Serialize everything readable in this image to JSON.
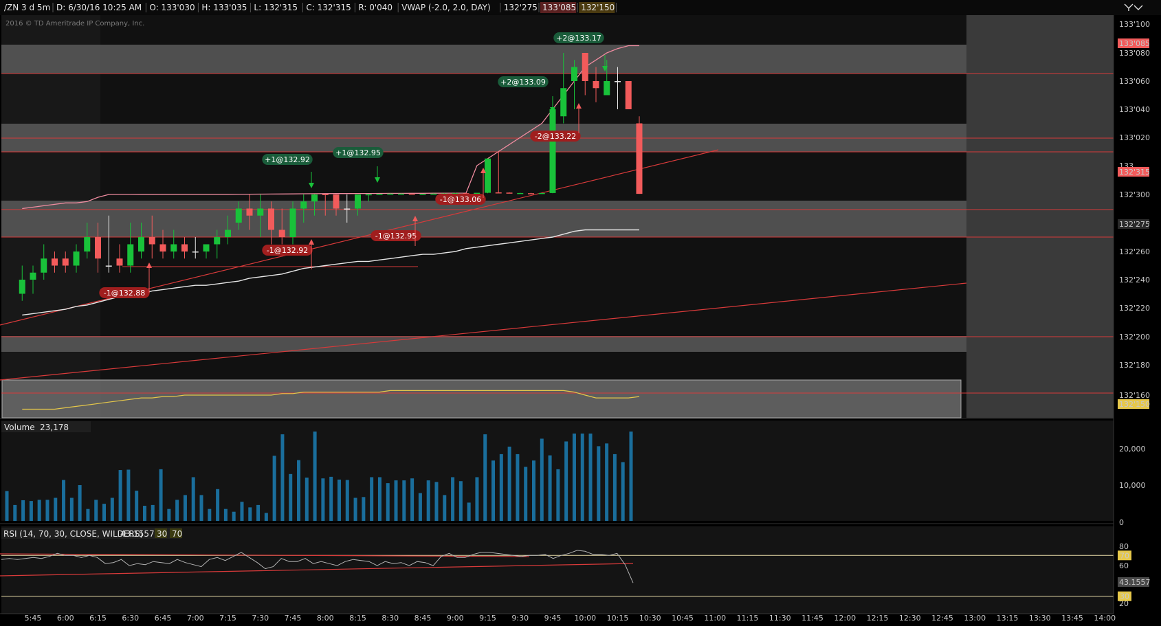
{
  "header": {
    "fields": [
      {
        "text": "/ZN 3 d 5m",
        "color": "#e6e6e6"
      },
      {
        "text": "D: 6/30/16 10:25 AM",
        "color": "#e6e6e6"
      },
      {
        "text": "O: 133'030",
        "color": "#e6e6e6"
      },
      {
        "text": "H: 133'035",
        "color": "#e6e6e6"
      },
      {
        "text": "L: 132'315",
        "color": "#e6e6e6"
      },
      {
        "text": "C: 132'315",
        "color": "#e6e6e6"
      },
      {
        "text": "R: 0'040",
        "color": "#e6e6e6"
      },
      {
        "text": "VWAP (-2.0, 2.0, DAY)",
        "color": "#ffffff"
      },
      {
        "text": "132'275",
        "color": "#ffffff"
      },
      {
        "text": "133'085",
        "color": "#f08c8c"
      },
      {
        "text": "132'150",
        "color": "#e6c84a"
      }
    ],
    "icon": "expand-collapse-icon"
  },
  "watermark": "2016 © TD Ameritrade IP Company, Inc.",
  "colors": {
    "up": "#19c23a",
    "down": "#f25b5b",
    "vwap": "#e6e6e6",
    "band_upper": "#f08ca0",
    "band_lower": "#e6c84a",
    "volume": "#1a6e9c",
    "rsi": "#b4b4b4",
    "ref_line": "#d83a3a",
    "zone": "#5a5a5a",
    "tag_buy": "#1a5c3a",
    "tag_sell": "#a01e1e"
  },
  "chart_data": [
    {
      "type": "candlestick",
      "panel": "price",
      "x": [
        "5:40",
        "5:45",
        "5:50",
        "5:55",
        "6:00",
        "6:05",
        "6:10",
        "6:15",
        "6:20",
        "6:25",
        "6:30",
        "6:35",
        "6:40",
        "6:45",
        "6:50",
        "6:55",
        "7:00",
        "7:05",
        "7:10",
        "7:15",
        "7:20",
        "7:25",
        "7:30",
        "7:35",
        "7:40",
        "7:45",
        "7:50",
        "7:55",
        "8:00",
        "8:05",
        "8:10",
        "8:15",
        "8:20",
        "8:25",
        "8:30",
        "8:35",
        "8:40",
        "8:45",
        "8:50",
        "8:55",
        "9:00",
        "9:05",
        "9:10",
        "9:15",
        "9:20",
        "9:25",
        "9:30",
        "9:35",
        "9:40",
        "9:45",
        "9:50",
        "9:55",
        "10:00",
        "10:05",
        "10:10",
        "10:15",
        "10:20",
        "10:25"
      ],
      "open": [
        132.23,
        132.24,
        132.245,
        132.255,
        132.255,
        132.25,
        132.26,
        132.27,
        132.25,
        132.255,
        132.25,
        132.26,
        132.27,
        132.265,
        132.26,
        132.265,
        132.26,
        132.26,
        132.265,
        132.27,
        132.28,
        132.29,
        132.285,
        132.29,
        132.275,
        132.27,
        132.29,
        132.295,
        132.31,
        132.3,
        132.29,
        132.29,
        132.3,
        132.305,
        132.31,
        132.315,
        132.32,
        132.31,
        132.315,
        132.32,
        132.325,
        132.33,
        132.325,
        132.34,
        132.35,
        132.345,
        132.33,
        132.33,
        132.325,
        132.335,
        133.035,
        133.06,
        133.08,
        133.06,
        133.05,
        133.06,
        133.06,
        133.03
      ],
      "high": [
        132.25,
        132.25,
        132.265,
        132.26,
        132.26,
        132.265,
        132.28,
        132.28,
        132.285,
        132.265,
        132.28,
        132.28,
        132.285,
        132.275,
        132.275,
        132.27,
        132.27,
        132.265,
        132.275,
        132.285,
        132.295,
        132.3,
        132.3,
        132.295,
        132.29,
        132.295,
        132.305,
        132.31,
        132.31,
        132.305,
        132.3,
        132.3,
        132.315,
        132.315,
        132.325,
        132.325,
        132.32,
        132.315,
        132.325,
        132.33,
        132.34,
        132.34,
        132.335,
        133.005,
        133.01,
        132.35,
        132.34,
        132.34,
        132.335,
        133.045,
        133.08,
        133.075,
        133.08,
        133.07,
        133.075,
        133.07,
        133.06,
        133.035
      ],
      "low": [
        132.225,
        132.23,
        132.24,
        132.245,
        132.245,
        132.245,
        132.255,
        132.245,
        132.245,
        132.245,
        132.245,
        132.255,
        132.255,
        132.255,
        132.255,
        132.255,
        132.255,
        132.255,
        132.255,
        132.265,
        132.275,
        132.275,
        132.27,
        132.265,
        132.265,
        132.265,
        132.28,
        132.285,
        132.285,
        132.285,
        132.28,
        132.285,
        132.295,
        132.3,
        132.3,
        132.305,
        132.305,
        132.3,
        132.305,
        132.31,
        132.32,
        132.32,
        132.32,
        132.33,
        132.34,
        132.33,
        132.32,
        132.32,
        132.32,
        132.33,
        133.03,
        133.04,
        133.05,
        133.045,
        133.05,
        133.04,
        133.04,
        132.315
      ],
      "close": [
        132.24,
        132.245,
        132.255,
        132.25,
        132.25,
        132.26,
        132.27,
        132.255,
        132.25,
        132.25,
        132.265,
        132.27,
        132.265,
        132.26,
        132.265,
        132.26,
        132.26,
        132.265,
        132.27,
        132.275,
        132.29,
        132.285,
        132.29,
        132.275,
        132.27,
        132.29,
        132.295,
        132.3,
        132.3,
        132.29,
        132.29,
        132.3,
        132.305,
        132.315,
        132.32,
        132.32,
        132.31,
        132.315,
        132.32,
        132.325,
        132.33,
        132.325,
        132.34,
        133.005,
        132.345,
        132.335,
        132.335,
        132.325,
        132.335,
        133.04,
        133.055,
        133.07,
        133.06,
        133.055,
        133.06,
        133.06,
        133.04,
        132.315
      ]
    },
    {
      "type": "line",
      "panel": "price",
      "series": [
        {
          "name": "VWAP",
          "values": [
            132.215,
            132.216,
            132.217,
            132.218,
            132.219,
            132.221,
            132.222,
            132.224,
            132.226,
            132.228,
            132.229,
            132.23,
            132.232,
            132.233,
            132.234,
            132.235,
            132.236,
            132.236,
            132.237,
            132.238,
            132.239,
            132.241,
            132.242,
            132.243,
            132.244,
            132.246,
            132.248,
            132.249,
            132.25,
            132.251,
            132.252,
            132.253,
            132.253,
            132.254,
            132.255,
            132.256,
            132.257,
            132.258,
            132.258,
            132.259,
            132.26,
            132.262,
            132.263,
            132.264,
            132.265,
            132.266,
            132.267,
            132.268,
            132.269,
            132.27,
            132.272,
            132.274,
            132.275,
            132.275,
            132.275,
            132.275,
            132.275,
            132.275
          ]
        },
        {
          "name": "133'085",
          "values": [
            132.29,
            132.291,
            132.292,
            132.293,
            132.294,
            132.294,
            132.295,
            132.298,
            132.3,
            132.301,
            132.302,
            132.303,
            132.304,
            132.305,
            132.305,
            132.305,
            132.305,
            132.305,
            132.305,
            132.305,
            132.306,
            132.307,
            132.308,
            132.31,
            132.312,
            132.314,
            132.316,
            132.318,
            132.32,
            132.321,
            132.322,
            132.323,
            132.324,
            132.325,
            132.326,
            132.327,
            132.328,
            132.329,
            132.33,
            132.331,
            132.332,
            132.334,
            133.0,
            133.005,
            133.01,
            133.015,
            133.02,
            133.025,
            133.03,
            133.04,
            133.05,
            133.06,
            133.07,
            133.075,
            133.08,
            133.083,
            133.085,
            133.085
          ]
        },
        {
          "name": "132'150",
          "values": [
            132.15,
            132.15,
            132.15,
            132.15,
            132.151,
            132.152,
            132.153,
            132.154,
            132.155,
            132.156,
            132.157,
            132.158,
            132.158,
            132.159,
            132.159,
            132.16,
            132.16,
            132.16,
            132.16,
            132.16,
            132.16,
            132.16,
            132.16,
            132.16,
            132.161,
            132.161,
            132.162,
            132.162,
            132.162,
            132.162,
            132.162,
            132.162,
            132.162,
            132.162,
            132.163,
            132.163,
            132.163,
            132.163,
            132.163,
            132.163,
            132.163,
            132.163,
            132.163,
            132.163,
            132.163,
            132.163,
            132.163,
            132.163,
            132.163,
            132.163,
            132.163,
            132.162,
            132.16,
            132.158,
            132.158,
            132.158,
            132.158,
            132.159
          ]
        }
      ],
      "ylim": [
        132.15,
        133.1
      ],
      "y_ticks": [
        "133'100",
        "133'080",
        "133'060",
        "133'040",
        "133'020",
        "133",
        "132'300",
        "132'280",
        "132'260",
        "132'240",
        "132'220",
        "132'200",
        "132'180",
        "132'160"
      ],
      "price_tags": [
        {
          "text": "133'085",
          "color": "#f25b5b"
        },
        {
          "text": "132'315",
          "color": "#f25b5b"
        },
        {
          "text": "132'275",
          "color": "#2a2a2a"
        },
        {
          "text": "132'150",
          "color": "#e6c84a"
        }
      ],
      "trade_tags": [
        {
          "text": "-1@132.88",
          "side": "sell"
        },
        {
          "text": "-1@132.92",
          "side": "sell"
        },
        {
          "text": "+1@132.92",
          "side": "buy"
        },
        {
          "text": "+1@132.95",
          "side": "buy"
        },
        {
          "text": "-1@132.95",
          "side": "sell"
        },
        {
          "text": "-1@133.06",
          "side": "sell"
        },
        {
          "text": "+2@133.09",
          "side": "buy"
        },
        {
          "text": "+2@133.17",
          "side": "buy"
        },
        {
          "text": "-2@133.22",
          "side": "sell"
        }
      ],
      "x_ticks": [
        "5:45",
        "6:00",
        "6:15",
        "6:30",
        "6:45",
        "7:00",
        "7:15",
        "7:30",
        "7:45",
        "8:00",
        "8:15",
        "8:30",
        "8:45",
        "9:00",
        "9:15",
        "9:30",
        "9:45",
        "10:00",
        "10:15",
        "10:30",
        "10:45",
        "11:00",
        "11:15",
        "11:30",
        "11:45",
        "12:00",
        "12:15",
        "12:30",
        "12:45",
        "13:00",
        "13:15",
        "13:30",
        "13:45",
        "14:00"
      ]
    },
    {
      "type": "bar",
      "panel": "volume",
      "title": "Volume",
      "last_value": "23,178",
      "values": [
        7500,
        4000,
        5200,
        5000,
        5300,
        5300,
        5800,
        10300,
        5800,
        9000,
        3000,
        5300,
        4300,
        5800,
        12800,
        12900,
        7600,
        3800,
        4000,
        13000,
        3000,
        5300,
        6500,
        11000,
        6500,
        3000,
        8000,
        3000,
        2300,
        4800,
        3400,
        4000,
        2000,
        16400,
        21800,
        11800,
        15300,
        10900,
        22900,
        10700,
        11100,
        10400,
        10300,
        5800,
        6000,
        11000,
        11000,
        9500,
        10200,
        10200,
        10700,
        7000,
        10200,
        9800,
        6500,
        11000,
        10000,
        4600,
        11000,
        21800,
        15200,
        16800,
        18700,
        16800,
        13600,
        15200,
        20700,
        16500,
        13000,
        20000,
        22000,
        22000,
        22000,
        18800,
        19500,
        16800,
        14800,
        23178
      ],
      "y_ticks": [
        "20,000",
        "10,000",
        "0"
      ],
      "ylim": [
        0,
        22500
      ]
    },
    {
      "type": "line",
      "panel": "rsi",
      "title": "RSI (14, 70, 30, CLOSE, WILDERS)",
      "last_value": "43.1557",
      "levels": [
        "30",
        "70"
      ],
      "values": [
        66,
        67,
        66,
        67,
        68,
        67,
        69,
        72,
        70,
        70,
        68,
        70,
        68,
        62,
        63,
        66,
        60,
        62,
        61,
        64,
        63,
        62,
        66,
        63,
        61,
        59,
        66,
        68,
        65,
        69,
        73,
        68,
        63,
        57,
        59,
        67,
        64,
        64,
        67,
        62,
        64,
        62,
        60,
        64,
        66,
        65,
        64,
        60,
        64,
        62,
        63,
        60,
        64,
        63,
        60,
        69,
        72,
        68,
        68,
        71,
        73,
        73,
        72,
        71,
        70,
        69,
        70,
        70,
        71,
        67,
        70,
        72,
        75,
        74,
        71,
        71,
        70,
        72,
        61,
        43.1557
      ],
      "y_ticks": [
        "80",
        "60",
        "40",
        "20"
      ],
      "ylim": [
        15,
        85
      ]
    }
  ]
}
